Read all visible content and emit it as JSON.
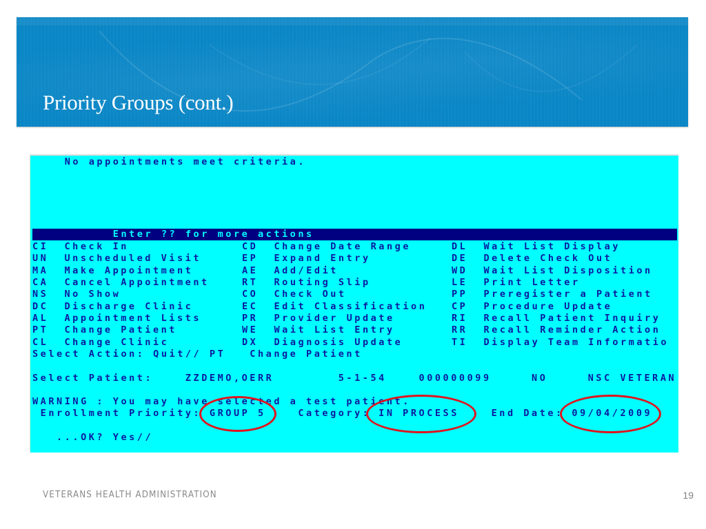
{
  "slide": {
    "title": "Priority Groups (cont.)",
    "footer": "VETERANS HEALTH ADMINISTRATION",
    "page_number": "19",
    "colors": {
      "banner": "#0a86c6",
      "terminal_bg": "#00ffff",
      "terminal_text": "#0a1aa0",
      "highlight_bar": "#000080",
      "annotation": "#e0141e"
    }
  },
  "terminal": {
    "message": "    No appointments meet criteria.",
    "action_bar": "          Enter ?? for more actions",
    "actions": [
      {
        "code": "CI",
        "label": "Check In"
      },
      {
        "code": "UN",
        "label": "Unscheduled Visit"
      },
      {
        "code": "MA",
        "label": "Make Appointment"
      },
      {
        "code": "CA",
        "label": "Cancel Appointment"
      },
      {
        "code": "NS",
        "label": "No Show"
      },
      {
        "code": "DC",
        "label": "Discharge Clinic"
      },
      {
        "code": "AL",
        "label": "Appointment Lists"
      },
      {
        "code": "PT",
        "label": "Change Patient"
      },
      {
        "code": "CL",
        "label": "Change Clinic"
      },
      {
        "code": "CD",
        "label": "Change Date Range"
      },
      {
        "code": "EP",
        "label": "Expand Entry"
      },
      {
        "code": "AE",
        "label": "Add/Edit"
      },
      {
        "code": "RT",
        "label": "Routing Slip"
      },
      {
        "code": "CO",
        "label": "Check Out"
      },
      {
        "code": "EC",
        "label": "Edit Classification"
      },
      {
        "code": "PR",
        "label": "Provider Update"
      },
      {
        "code": "WE",
        "label": "Wait List Entry"
      },
      {
        "code": "DX",
        "label": "Diagnosis Update"
      },
      {
        "code": "DL",
        "label": "Wait List Display"
      },
      {
        "code": "DE",
        "label": "Delete Check Out"
      },
      {
        "code": "WD",
        "label": "Wait List Disposition"
      },
      {
        "code": "LE",
        "label": "Print Letter"
      },
      {
        "code": "PP",
        "label": "Preregister a Patient"
      },
      {
        "code": "CP",
        "label": "Procedure Update"
      },
      {
        "code": "RI",
        "label": "Recall Patient Inquiry"
      },
      {
        "code": "RR",
        "label": "Recall Reminder Action"
      },
      {
        "code": "TI",
        "label": "Display Team Informatio"
      }
    ],
    "select_action": "Select Action: Quit// PT   Change Patient",
    "select_patient": "Select Patient:    ZZDEMO,OERR        5-1-54    000000099     NO     NSC VETERAN",
    "warning": "WARNING : You may have selected a test patient.",
    "enrollment": " Enrollment Priority: GROUP 5    Category: IN PROCESS    End Date: 09/04/2009",
    "ok_prompt": "   ...OK? Yes//",
    "patient": {
      "name": "ZZDEMO,OERR",
      "dob": "5-1-54",
      "ssn": "000000099",
      "flag": "NO",
      "type": "NSC VETERAN",
      "enrollment_priority": "GROUP 5",
      "category": "IN PROCESS",
      "end_date": "09/04/2009"
    }
  }
}
